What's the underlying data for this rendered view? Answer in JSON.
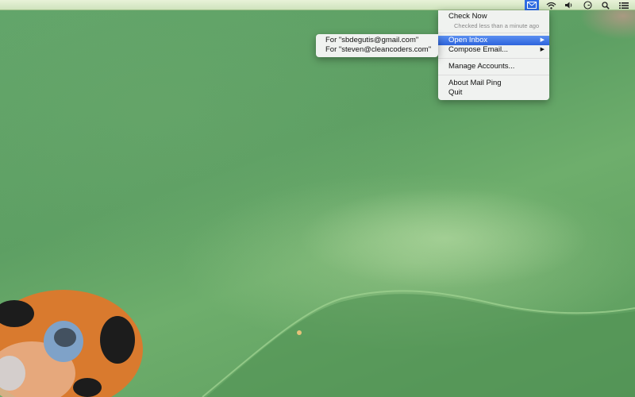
{
  "menubar": {
    "icons": [
      {
        "name": "mail-icon",
        "active": true
      },
      {
        "name": "wifi-icon"
      },
      {
        "name": "volume-icon"
      },
      {
        "name": "time-machine-icon"
      },
      {
        "name": "spotlight-icon"
      },
      {
        "name": "list-icon"
      }
    ],
    "active_color": "#2f6ce3"
  },
  "mail_menu": {
    "check_now": "Check Now",
    "status": "Checked less than a minute ago",
    "open_inbox": "Open Inbox",
    "compose_email": "Compose Email...",
    "manage_accounts": "Manage Accounts...",
    "about": "About Mail Ping",
    "quit": "Quit",
    "highlight_color": "#3a73e4"
  },
  "inbox_submenu": {
    "items": [
      "For \"sbdegutis@gmail.com\"",
      "For \"steven@cleancoders.com\""
    ]
  }
}
